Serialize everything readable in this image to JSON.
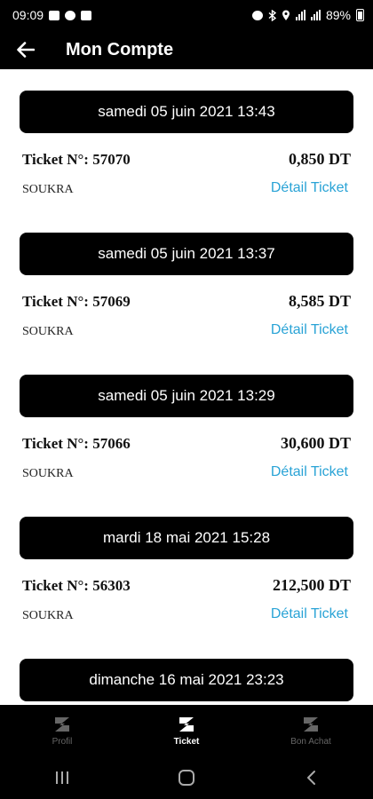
{
  "status_bar": {
    "time": "09:09",
    "battery": "89%",
    "left_icons": [
      "image-icon",
      "notification-icon",
      "mail-icon"
    ],
    "right_icons": [
      "alarm-icon",
      "bluetooth-icon",
      "location-icon",
      "wifi-icon",
      "signal-icon",
      "battery-icon"
    ]
  },
  "app_bar": {
    "title": "Mon Compte",
    "back_icon": "arrow-left-icon"
  },
  "tickets": [
    {
      "date": "samedi 05 juin 2021 13:43",
      "ticket_label": "Ticket N°: 57070",
      "amount": "0,850 DT",
      "location": "SOUKRA",
      "detail_label": "Détail Ticket"
    },
    {
      "date": "samedi 05 juin 2021 13:37",
      "ticket_label": "Ticket N°: 57069",
      "amount": "8,585 DT",
      "location": "SOUKRA",
      "detail_label": "Détail Ticket"
    },
    {
      "date": "samedi 05 juin 2021 13:29",
      "ticket_label": "Ticket N°: 57066",
      "amount": "30,600 DT",
      "location": "SOUKRA",
      "detail_label": "Détail Ticket"
    },
    {
      "date": "mardi 18 mai 2021 15:28",
      "ticket_label": "Ticket N°: 56303",
      "amount": "212,500 DT",
      "location": "SOUKRA",
      "detail_label": "Détail Ticket"
    },
    {
      "date": "dimanche 16 mai 2021 23:23",
      "ticket_label": "",
      "amount": "",
      "location": "",
      "detail_label": ""
    }
  ],
  "bottom_nav": [
    {
      "label": "Profil",
      "icon": "z-logo-icon",
      "active": false
    },
    {
      "label": "Ticket",
      "icon": "z-logo-icon",
      "active": true
    },
    {
      "label": "Bon Achat",
      "icon": "z-logo-icon",
      "active": false
    }
  ],
  "system_nav": {
    "icons": [
      "recent-apps-icon",
      "home-icon",
      "back-icon"
    ]
  },
  "colors": {
    "link": "#29a3d6",
    "bar": "#000000",
    "background": "#ffffff"
  }
}
